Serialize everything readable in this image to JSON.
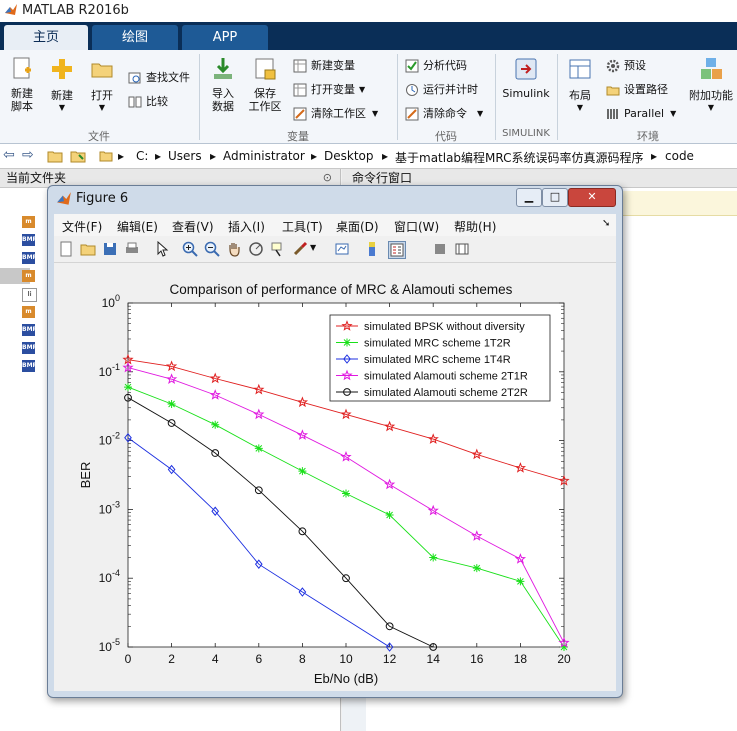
{
  "app": {
    "title": "MATLAB R2016b"
  },
  "tabs": [
    {
      "label": "主页"
    },
    {
      "label": "绘图"
    },
    {
      "label": "APP"
    }
  ],
  "ribbon": {
    "file": {
      "new_script": "新建\n脚本",
      "new": "新建",
      "open": "打开",
      "find_files": "查找文件",
      "compare": "比较",
      "group": "文件"
    },
    "variable": {
      "import": "导入\n数据",
      "save_ws": "保存\n工作区",
      "new_var": "新建变量",
      "open_var": "打开变量",
      "clear_ws": "清除工作区",
      "group": "变量"
    },
    "code": {
      "analyze": "分析代码",
      "run_time": "运行并计时",
      "clear_cmd": "清除命令",
      "group": "代码"
    },
    "simulink": {
      "label": "Simulink",
      "group": "SIMULINK"
    },
    "env": {
      "layout": "布局",
      "prefs": "预设",
      "set_path": "设置路径",
      "parallel": "Parallel",
      "addons": "附加功能",
      "group": "环境"
    }
  },
  "address": {
    "crumbs": [
      "C:",
      "Users",
      "Administrator",
      "Desktop",
      "基于matlab编程MRC系统误码率仿真源码程序",
      "code"
    ]
  },
  "left_panel": {
    "title": "当前文件夹"
  },
  "right_panel": {
    "title": "命令行窗口"
  },
  "figure": {
    "title": "Figure 6",
    "menus": [
      "文件(F)",
      "编辑(E)",
      "查看(V)",
      "插入(I)",
      "工具(T)",
      "桌面(D)",
      "窗口(W)",
      "帮助(H)"
    ]
  },
  "chart_data": {
    "type": "line",
    "title": "Comparison of performance of MRC & Alamouti schemes",
    "xlabel": "Eb/No (dB)",
    "ylabel": "BER",
    "xlim": [
      0,
      20
    ],
    "ylim": [
      1e-05,
      1
    ],
    "yscale": "log",
    "xticks": [
      "0",
      "2",
      "4",
      "6",
      "8",
      "10",
      "12",
      "14",
      "16",
      "18",
      "20"
    ],
    "yticks": [
      {
        "base": "10",
        "exp": "0"
      },
      {
        "base": "10",
        "exp": "-1"
      },
      {
        "base": "10",
        "exp": "-2"
      },
      {
        "base": "10",
        "exp": "-3"
      },
      {
        "base": "10",
        "exp": "-4"
      },
      {
        "base": "10",
        "exp": "-5"
      }
    ],
    "legend_position": "top-right",
    "series": [
      {
        "name": "simulated BPSK without diversity",
        "color": "#e02020",
        "marker": "star",
        "x": [
          0,
          2,
          4,
          6,
          8,
          10,
          12,
          14,
          16,
          18,
          20
        ],
        "y": [
          0.15,
          0.12,
          0.08,
          0.055,
          0.036,
          0.024,
          0.016,
          0.0105,
          0.0063,
          0.004,
          0.0026
        ]
      },
      {
        "name": "simulated MRC scheme 1T2R",
        "color": "#19e019",
        "marker": "asterisk",
        "x": [
          0,
          2,
          4,
          6,
          8,
          10,
          12,
          14,
          16,
          18,
          20
        ],
        "y": [
          0.06,
          0.034,
          0.017,
          0.0077,
          0.0036,
          0.0017,
          0.00083,
          0.0002,
          0.00014,
          9e-05,
          1e-05
        ]
      },
      {
        "name": "simulated MRC scheme 1T4R",
        "color": "#1c2fe0",
        "marker": "diamond",
        "x": [
          0,
          2,
          4,
          6,
          8,
          12
        ],
        "y": [
          0.011,
          0.0038,
          0.00094,
          0.00016,
          6.3e-05,
          1e-05
        ]
      },
      {
        "name": "simulated Alamouti scheme 2T1R",
        "color": "#e019e0",
        "marker": "star",
        "x": [
          0,
          2,
          4,
          6,
          8,
          10,
          12,
          14,
          16,
          18,
          20
        ],
        "y": [
          0.115,
          0.078,
          0.046,
          0.024,
          0.012,
          0.0058,
          0.0023,
          0.00096,
          0.00041,
          0.00019,
          1.15e-05
        ]
      },
      {
        "name": "simulated Alamouti scheme 2T2R",
        "color": "#111111",
        "marker": "circle",
        "x": [
          0,
          2,
          4,
          6,
          8,
          10,
          12,
          14
        ],
        "y": [
          0.042,
          0.018,
          0.0066,
          0.0019,
          0.00048,
          0.0001,
          2e-05,
          1e-05
        ]
      }
    ]
  }
}
